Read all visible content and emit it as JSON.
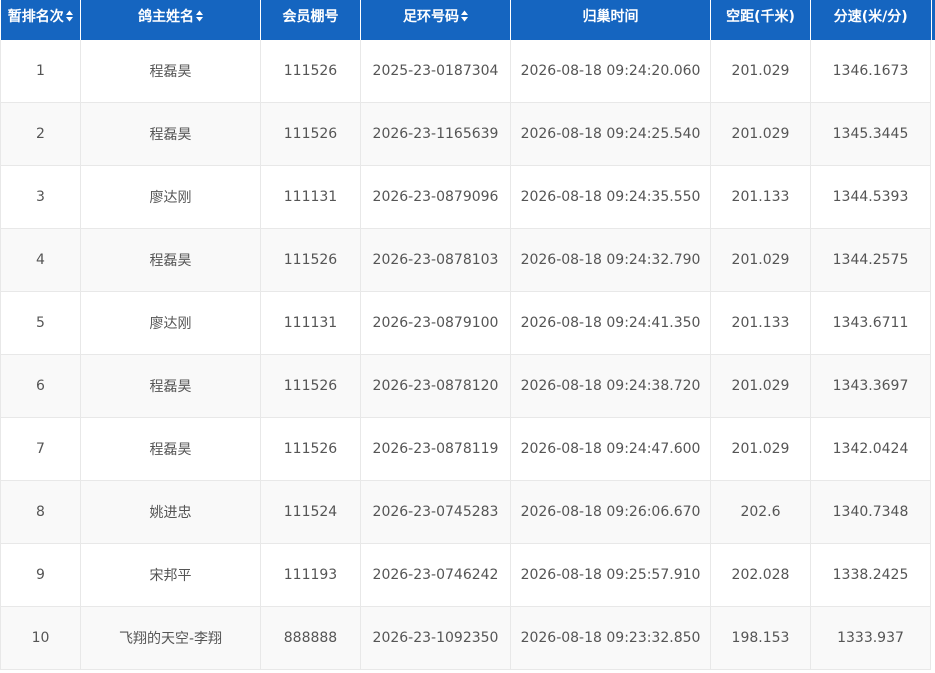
{
  "table": {
    "columns": [
      {
        "label": "暂排名次",
        "sortable": true
      },
      {
        "label": "鸽主姓名",
        "sortable": true
      },
      {
        "label": "会员棚号",
        "sortable": false
      },
      {
        "label": "足环号码",
        "sortable": true
      },
      {
        "label": "归巢时间",
        "sortable": false
      },
      {
        "label": "空距(千米)",
        "sortable": false
      },
      {
        "label": "分速(米/分)",
        "sortable": false
      }
    ],
    "rows": [
      {
        "rank": "1",
        "owner": "程磊昊",
        "loft": "111526",
        "ring": "2025-23-0187304",
        "time": "2026-08-18 09:24:20.060",
        "distance": "201.029",
        "speed": "1346.1673"
      },
      {
        "rank": "2",
        "owner": "程磊昊",
        "loft": "111526",
        "ring": "2026-23-1165639",
        "time": "2026-08-18 09:24:25.540",
        "distance": "201.029",
        "speed": "1345.3445"
      },
      {
        "rank": "3",
        "owner": "廖达刚",
        "loft": "111131",
        "ring": "2026-23-0879096",
        "time": "2026-08-18 09:24:35.550",
        "distance": "201.133",
        "speed": "1344.5393"
      },
      {
        "rank": "4",
        "owner": "程磊昊",
        "loft": "111526",
        "ring": "2026-23-0878103",
        "time": "2026-08-18 09:24:32.790",
        "distance": "201.029",
        "speed": "1344.2575"
      },
      {
        "rank": "5",
        "owner": "廖达刚",
        "loft": "111131",
        "ring": "2026-23-0879100",
        "time": "2026-08-18 09:24:41.350",
        "distance": "201.133",
        "speed": "1343.6711"
      },
      {
        "rank": "6",
        "owner": "程磊昊",
        "loft": "111526",
        "ring": "2026-23-0878120",
        "time": "2026-08-18 09:24:38.720",
        "distance": "201.029",
        "speed": "1343.3697"
      },
      {
        "rank": "7",
        "owner": "程磊昊",
        "loft": "111526",
        "ring": "2026-23-0878119",
        "time": "2026-08-18 09:24:47.600",
        "distance": "201.029",
        "speed": "1342.0424"
      },
      {
        "rank": "8",
        "owner": "姚进忠",
        "loft": "111524",
        "ring": "2026-23-0745283",
        "time": "2026-08-18 09:26:06.670",
        "distance": "202.6",
        "speed": "1340.7348"
      },
      {
        "rank": "9",
        "owner": "宋邦平",
        "loft": "111193",
        "ring": "2026-23-0746242",
        "time": "2026-08-18 09:25:57.910",
        "distance": "202.028",
        "speed": "1338.2425"
      },
      {
        "rank": "10",
        "owner": "飞翔的天空-李翔",
        "loft": "888888",
        "ring": "2026-23-1092350",
        "time": "2026-08-18 09:23:32.850",
        "distance": "198.153",
        "speed": "1333.937"
      }
    ]
  },
  "colors": {
    "header_bg": "#1565c0",
    "header_text": "#ffffff",
    "cell_text": "#555555",
    "row_alt_bg": "#f9f9f9",
    "grid_line": "#e8e8e8"
  },
  "icons": {
    "sort": "sort-updown-icon"
  }
}
